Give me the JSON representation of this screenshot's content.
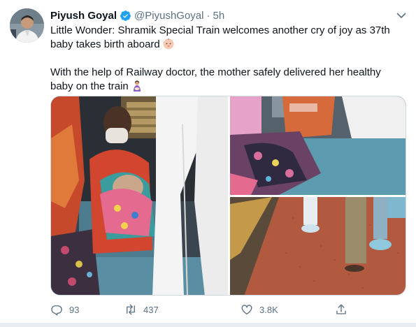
{
  "tweet": {
    "author_name": "Piyush Goyal",
    "handle": "@PiyushGoyal",
    "separator": "·",
    "time": "5h",
    "text_line1": "Little Wonder: Shramik Special Train welcomes another cry of joy as 37th baby takes birth aboard",
    "text_line2": "With the help of Railway doctor, the mother safely delivered her healthy baby on the train",
    "emoji1": "baby-emoji",
    "emoji2": "woman-feeding-baby-emoji"
  },
  "media": {
    "photos": [
      "photo-mother-with-newborn",
      "photo-baby-on-train-berth",
      "photo-platform-feet"
    ]
  },
  "actions": {
    "reply_count": "93",
    "retweet_count": "437",
    "like_count": "3.8K"
  },
  "icons": {
    "verified": "verified-badge-icon",
    "caret": "chevron-down-icon",
    "reply": "reply-icon",
    "retweet": "retweet-icon",
    "like": "heart-icon",
    "share": "share-icon"
  },
  "colors": {
    "verified_blue": "#1da1f2",
    "secondary_text": "#5b7083",
    "primary_text": "#0f1419",
    "divider": "#e6ecf0"
  }
}
